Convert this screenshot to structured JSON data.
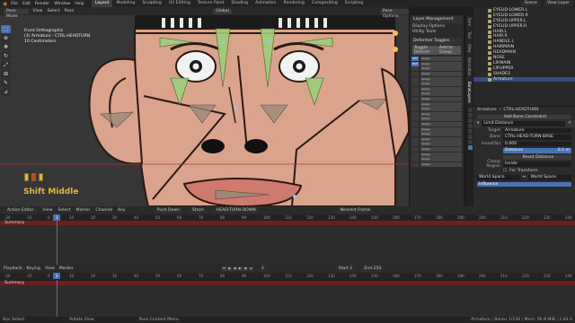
{
  "topbar": {
    "menus": [
      "File",
      "Edit",
      "Render",
      "Window",
      "Help"
    ],
    "tabs": [
      "Layout",
      "Modeling",
      "Sculpting",
      "UV Editing",
      "Texture Paint",
      "Shading",
      "Animation",
      "Rendering",
      "Compositing",
      "Scripting"
    ],
    "active_tab": "Layout",
    "scene": "Scene",
    "view_layer": "View Layer"
  },
  "viewport_header": {
    "mode": "Pose Mode",
    "menus": [
      "View",
      "Select",
      "Pose"
    ],
    "orientation": "Global",
    "pose_options": "Pose Options"
  },
  "viewport_overlay": {
    "line1": "Front Orthographic",
    "line2": "(3) Armature : CTRL-HEADTURN",
    "line3": "10 Centimeters"
  },
  "shift_label": "Shift Middle",
  "nregion": {
    "section1": "Layer Management",
    "row1": "Display Options",
    "row2": "Utility Tools",
    "section2": "Deformer Toggles",
    "toggle1": "Toggle Deform",
    "toggle2": "Add to Group",
    "tabs": [
      "Item",
      "Tool",
      "View",
      "Animation",
      "BoneLayers",
      "Sketchfab"
    ]
  },
  "layers_small": [
    "OFF",
    "MCH",
    "",
    "",
    "",
    "",
    "",
    "",
    "",
    "",
    "",
    "",
    "",
    "",
    "",
    "",
    "",
    "",
    "",
    "",
    "",
    ""
  ],
  "assign_label": "Assign",
  "rig_labels": [
    "RGG",
    "CTRL"
  ],
  "outliner": {
    "items": [
      "EYELID-LOWER.L",
      "EYELID-LOWER.R",
      "EYELID-UPPER.L",
      "EYELID-UPPER.R",
      "HAIR.L",
      "HAIR.R",
      "HANDLE.L",
      "HAIRMAIN",
      "HEADMAIN",
      "NOSE",
      "LIP.MAIN",
      "LIP.UPPER",
      "SHADES",
      "Armature"
    ]
  },
  "props": {
    "breadcrumb_obj": "Armature",
    "breadcrumb_bone": "CTRL-HEADTURN",
    "add_constraint": "Add Bone Constraint",
    "constraint_name": "Limit Distance",
    "target_label": "Target",
    "target_value": "Armature",
    "bone_label": "Bone",
    "bone_value": "CTRL-HEAD-TURN-BASE",
    "headtail_label": "Head/Tail",
    "headtail_value": "0.000",
    "distance_label": "Distance",
    "distance_value": "0.1 m",
    "reset_label": "Reset Distance",
    "clamp_label": "Clamp Region",
    "clamp_value": "Inside",
    "for_transform": "For Transform",
    "owner_label": "World Space",
    "space_value": "World Space",
    "influence_label": "Influence"
  },
  "action_editor": {
    "mode": "Action Editor",
    "menus": [
      "View",
      "Select",
      "Marker",
      "Channel",
      "Key"
    ],
    "push_down": "Push Down",
    "stash": "Stash",
    "action_name": "HEAD-TURN-DOWN",
    "nearest_frame": "Nearest Frame",
    "ticks": [
      "-20",
      "-10",
      "0",
      "10",
      "20",
      "30",
      "40",
      "50",
      "60",
      "70",
      "80",
      "90",
      "100",
      "110",
      "120",
      "130",
      "140",
      "150",
      "160",
      "170",
      "180",
      "190",
      "200",
      "210",
      "220",
      "230",
      "240"
    ],
    "current_frame": "3",
    "summary": "Summary"
  },
  "timeline": {
    "menus": [
      "Playback",
      "Keying",
      "View",
      "Marker"
    ],
    "start_label": "Start",
    "start_value": "1",
    "end_label": "End",
    "end_value": "250",
    "frame_value": "3",
    "ticks": [
      "-20",
      "-10",
      "0",
      "10",
      "20",
      "30",
      "40",
      "50",
      "60",
      "70",
      "80",
      "90",
      "100",
      "110",
      "120",
      "130",
      "140",
      "150",
      "160",
      "170",
      "180",
      "190",
      "200",
      "210",
      "220",
      "230",
      "240"
    ],
    "current_frame": "3",
    "summary": "Summary"
  },
  "status": {
    "select": "Box Select",
    "rotate": "Rotate View",
    "context": "Pose Context Menu",
    "info": "Armature | Bones 1/134 | Mem: 96.8 MiB | 2.83.0"
  },
  "colors": {
    "accent": "#4772b3",
    "summary": "#6d1f1f",
    "skin": "#d9a38c",
    "bone_green": "#9bd07a",
    "shift_text": "#e2b43a"
  }
}
